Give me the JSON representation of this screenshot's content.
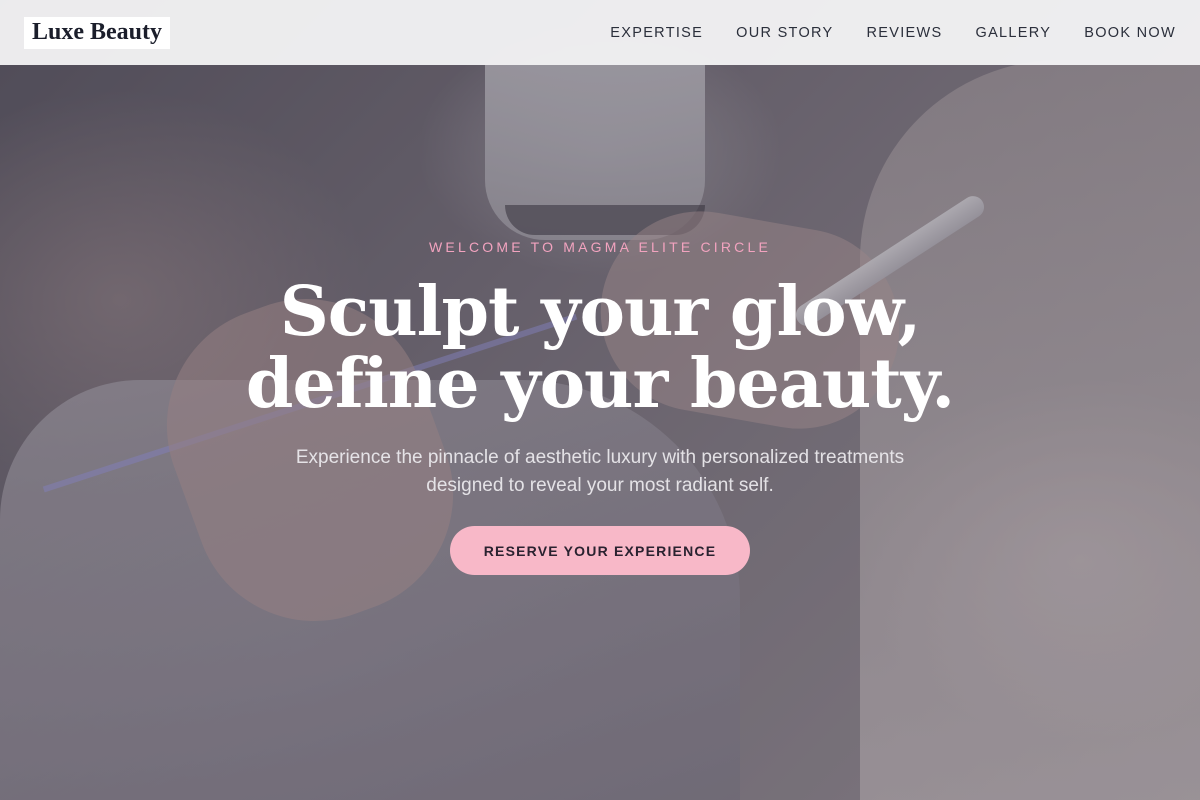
{
  "header": {
    "logo": "Luxe Beauty",
    "nav": [
      {
        "label": "EXPERTISE"
      },
      {
        "label": "OUR STORY"
      },
      {
        "label": "REVIEWS"
      },
      {
        "label": "GALLERY"
      },
      {
        "label": "BOOK NOW"
      }
    ]
  },
  "hero": {
    "eyebrow": "WELCOME TO MAGMA ELITE CIRCLE",
    "headline_line1": "Sculpt your glow,",
    "headline_line2": "define your beauty.",
    "subtitle_line1": "Experience the pinnacle of aesthetic luxury with personalized treatments",
    "subtitle_line2": "designed to reveal your most radiant self.",
    "cta_label": "RESERVE YOUR EXPERIENCE"
  },
  "colors": {
    "accent_pink": "#f8b8c8",
    "eyebrow_pink": "#f2a3bf",
    "text_dark": "#1b1e2b"
  }
}
